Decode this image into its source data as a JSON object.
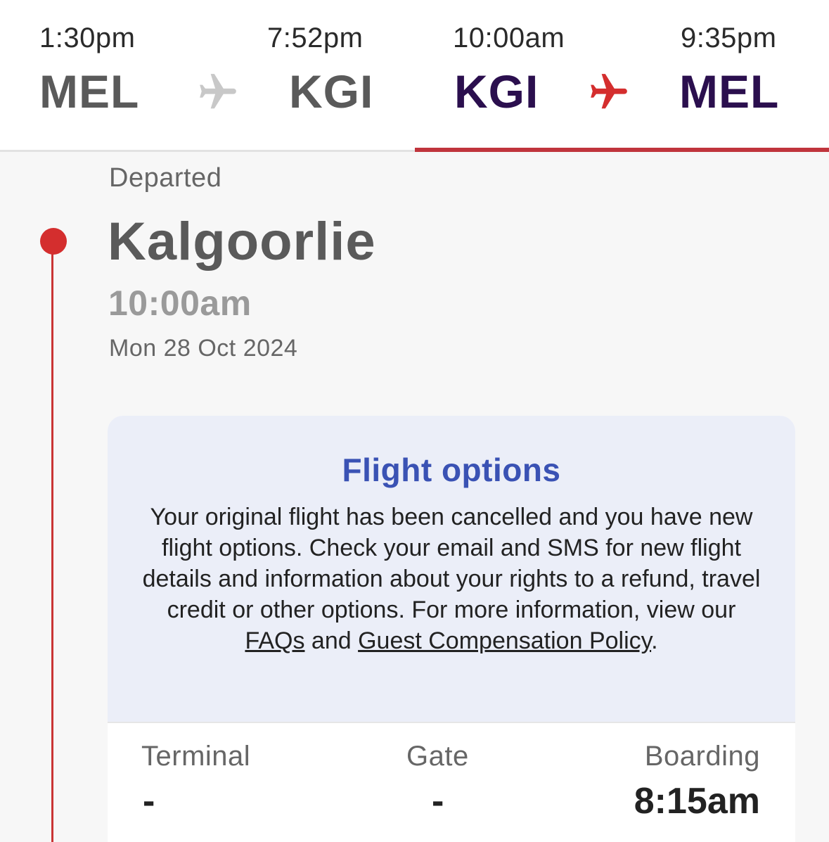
{
  "outbound": {
    "depart_time": "1:30pm",
    "arrive_time": "7:52pm",
    "origin": "MEL",
    "destination": "KGI",
    "plane_icon": "plane-icon",
    "plane_color": "#c8c8c8"
  },
  "return": {
    "depart_time": "10:00am",
    "arrive_time": "9:35pm",
    "origin": "KGI",
    "destination": "MEL",
    "plane_icon": "plane-icon",
    "plane_color": "#d42e2e"
  },
  "segment": {
    "status": "Departed",
    "city": "Kalgoorlie",
    "time": "10:00am",
    "date": "Mon 28 Oct 2024"
  },
  "flight_options": {
    "title": "Flight options",
    "body_text": "Your original flight has been cancelled and you have new flight options. Check your email and SMS for new flight details and information about your rights to a refund, travel credit or other options. For more information, view our ",
    "faqs_link": "FAQs",
    "and_text": " and ",
    "policy_link": "Guest Compensation Policy",
    "end_text": "."
  },
  "details": {
    "terminal_label": "Terminal",
    "terminal_value": "-",
    "gate_label": "Gate",
    "gate_value": "-",
    "boarding_label": "Boarding",
    "boarding_value": "8:15am"
  },
  "colors": {
    "accent_red": "#c0343c",
    "brand_purple": "#2b0f4e",
    "link_blue": "#3a52b4"
  }
}
